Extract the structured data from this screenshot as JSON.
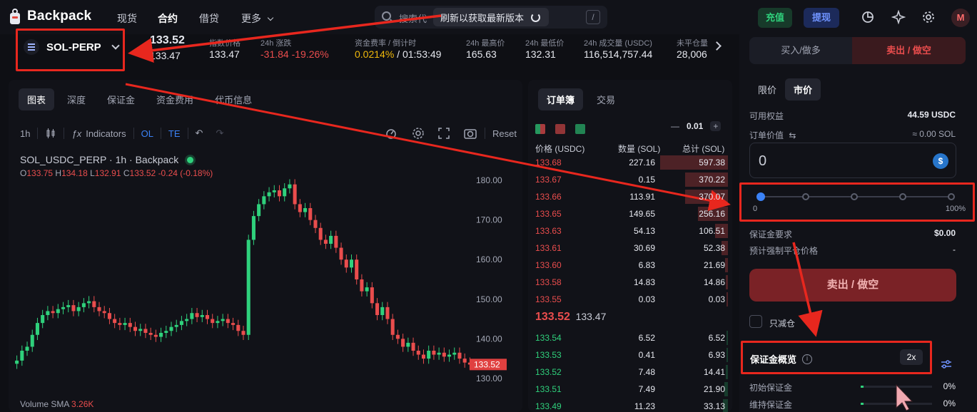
{
  "brand": {
    "name": "Backpack"
  },
  "nav": {
    "items": [
      "现货",
      "合约",
      "借贷",
      "更多"
    ]
  },
  "search": {
    "placeholder": "搜索代",
    "refresh_text": "刷新以获取最新版本",
    "shortcut": "/"
  },
  "header_actions": {
    "deposit": "充值",
    "withdraw": "提现",
    "avatar": "M"
  },
  "colors": {
    "accent_red": "#ea4d4d",
    "accent_green": "#2fd17c",
    "annotation": "#e8271e",
    "slider_blue": "#3b82f6"
  },
  "market": {
    "symbol": "SOL-PERP",
    "last_price": "133.52",
    "mark_price": "133.47",
    "stats": [
      {
        "label": "指数价格",
        "value": "133.47"
      },
      {
        "label": "24h 涨跌",
        "value": "-31.84 -19.26%"
      },
      {
        "label": "资金费率 / 倒计时",
        "value": "0.0214%",
        "value2": " / 01:53:49"
      },
      {
        "label": "24h 最高价",
        "value": "165.63"
      },
      {
        "label": "24h 最低价",
        "value": "132.31"
      },
      {
        "label": "24h 成交量 (USDC)",
        "value": "116,514,757.44"
      },
      {
        "label": "未平仓量",
        "value": "28,006"
      }
    ]
  },
  "chart_tabs": [
    "图表",
    "深度",
    "保证金",
    "资金费用",
    "代币信息"
  ],
  "toolbar": {
    "interval": "1h",
    "indicators": "Indicators",
    "ol": "OL",
    "te": "TE",
    "reset": "Reset"
  },
  "chart_header": {
    "title": "SOL_USDC_PERP · 1h · Backpack",
    "o_label": "O",
    "o": "133.75",
    "h_label": "H",
    "h": "134.18",
    "l_label": "L",
    "l": "132.91",
    "c_label": "C",
    "c": "133.52",
    "change": "-0.24 (-0.18%)",
    "volume_label": "Volume SMA",
    "volume_value": "3.26K"
  },
  "chart_data": {
    "type": "candlestick",
    "title": "SOL_USDC_PERP · 1h · Backpack",
    "y_ticks": [
      "180.00",
      "170.00",
      "160.00",
      "150.00",
      "140.00",
      "130.00"
    ],
    "ylim": [
      128,
      182
    ],
    "last_price_label": "133.52",
    "closes": [
      134.5,
      137,
      138,
      141,
      144,
      146,
      147,
      146.5,
      147.5,
      148,
      148.5,
      147,
      148,
      149,
      149.5,
      148,
      147,
      146.5,
      145,
      144,
      143.5,
      144,
      143,
      142,
      142.5,
      141.5,
      141,
      140.5,
      141.5,
      142,
      143,
      143.5,
      144.5,
      145,
      146.5,
      145.5,
      146,
      145,
      144,
      144.5,
      145,
      144,
      143.5,
      142,
      141,
      165,
      171,
      174,
      176,
      177,
      177.5,
      176,
      178,
      179,
      174,
      172,
      173,
      170,
      168,
      165,
      164,
      166,
      163,
      160,
      158,
      160,
      155,
      152,
      153,
      149,
      146,
      148,
      145,
      141,
      140,
      138,
      139,
      137,
      136,
      135,
      137,
      136,
      136.5,
      135.5,
      136,
      136.5,
      135,
      134,
      133.5
    ],
    "highs_over_close": 1.3,
    "lows_under_close": 1.3
  },
  "orderbook": {
    "tabs": [
      "订单簿",
      "交易"
    ],
    "tick": "0.01",
    "headers": {
      "price": "价格 (USDC)",
      "qty": "数量 (SOL)",
      "total": "总计 (SOL)"
    },
    "asks": [
      {
        "price": "133.68",
        "qty": "227.16",
        "total": "597.38",
        "depth": 0.95
      },
      {
        "price": "133.67",
        "qty": "0.15",
        "total": "370.22",
        "depth": 0.6
      },
      {
        "price": "133.66",
        "qty": "113.91",
        "total": "370.07",
        "depth": 0.6
      },
      {
        "price": "133.65",
        "qty": "149.65",
        "total": "256.16",
        "depth": 0.42
      },
      {
        "price": "133.63",
        "qty": "54.13",
        "total": "106.51",
        "depth": 0.18
      },
      {
        "price": "133.61",
        "qty": "30.69",
        "total": "52.38",
        "depth": 0.09
      },
      {
        "price": "133.60",
        "qty": "6.83",
        "total": "21.69",
        "depth": 0.04
      },
      {
        "price": "133.58",
        "qty": "14.83",
        "total": "14.86",
        "depth": 0.03
      },
      {
        "price": "133.55",
        "qty": "0.03",
        "total": "0.03",
        "depth": 0.005
      }
    ],
    "mid_price": "133.52",
    "mid_mark": "133.47",
    "bids": [
      {
        "price": "133.54",
        "qty": "6.52",
        "total": "6.52",
        "depth": 0.02
      },
      {
        "price": "133.53",
        "qty": "0.41",
        "total": "6.93",
        "depth": 0.02
      },
      {
        "price": "133.52",
        "qty": "7.48",
        "total": "14.41",
        "depth": 0.03
      },
      {
        "price": "133.51",
        "qty": "7.49",
        "total": "21.90",
        "depth": 0.05
      },
      {
        "price": "133.49",
        "qty": "11.23",
        "total": "33.13",
        "depth": 0.07
      }
    ]
  },
  "order_form": {
    "buy_label": "买入/做多",
    "sell_label": "卖出 / 做空",
    "types": [
      "限价",
      "市价"
    ],
    "available_label": "可用权益",
    "available_value": "44.59 USDC",
    "order_value_label": "订单价值",
    "order_value": "≈ 0.00 SOL",
    "amount": "0",
    "usdc_symbol": "$",
    "slider_min": "0",
    "slider_max": "100%",
    "slider_fraction": 0,
    "margin_req_label": "保证金要求",
    "margin_req_value": "$0.00",
    "liq_label": "预计强制平仓价格",
    "liq_value": "-",
    "submit_label": "卖出 / 做空",
    "reduce_only": "只减仓",
    "margin_overview": "保证金概览",
    "info_glyph": "i",
    "leverage": "2x",
    "init_margin_label": "初始保证金",
    "init_margin_value": "0%",
    "maint_margin_label": "维持保证金",
    "maint_margin_value": "0%"
  }
}
